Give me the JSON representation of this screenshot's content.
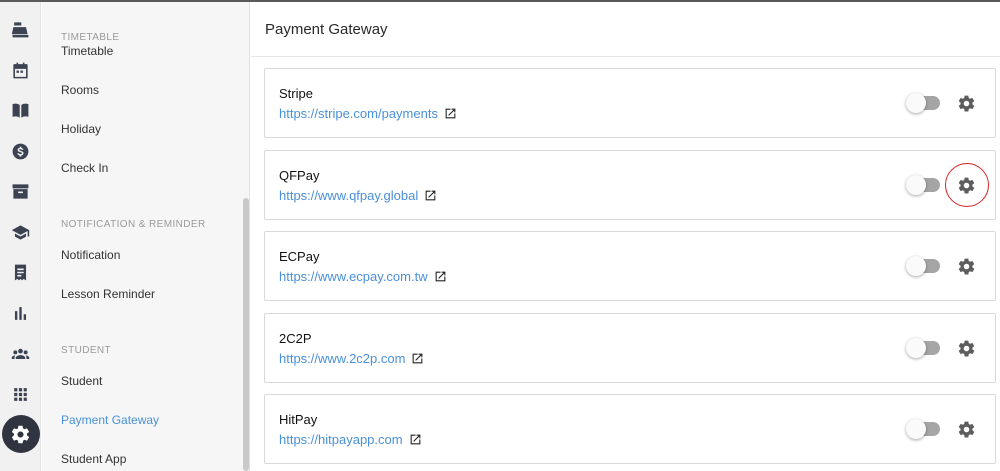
{
  "sidebar": {
    "sections": [
      {
        "heading": "TIMETABLE",
        "items": [
          "Timetable",
          "Rooms",
          "Holiday",
          "Check In"
        ]
      },
      {
        "heading": "NOTIFICATION & REMINDER",
        "items": [
          "Notification",
          "Lesson Reminder"
        ]
      },
      {
        "heading": "STUDENT",
        "items": [
          "Student",
          "Payment Gateway",
          "Student App"
        ]
      }
    ],
    "active_item": "Payment Gateway"
  },
  "rail_icons": [
    "cash-register-icon",
    "calendar-icon",
    "book-icon",
    "dollar-icon",
    "archive-icon",
    "graduation-cap-icon",
    "receipt-icon",
    "bar-chart-icon",
    "users-icon",
    "apps-grid-icon",
    "gear-icon"
  ],
  "main": {
    "title": "Payment Gateway",
    "gateways": [
      {
        "name": "Stripe",
        "url": "https://stripe.com/payments",
        "enabled": false
      },
      {
        "name": "QFPay",
        "url": "https://www.qfpay.global",
        "enabled": false,
        "highlighted": true
      },
      {
        "name": "ECPay",
        "url": "https://www.ecpay.com.tw",
        "enabled": false
      },
      {
        "name": "2C2P",
        "url": "https://www.2c2p.com",
        "enabled": false
      },
      {
        "name": "HitPay",
        "url": "https://hitpayapp.com",
        "enabled": false
      }
    ]
  },
  "colors": {
    "accent": "#4a90d9",
    "rail_active_bg": "#2f3440",
    "highlight": "#d62525"
  }
}
